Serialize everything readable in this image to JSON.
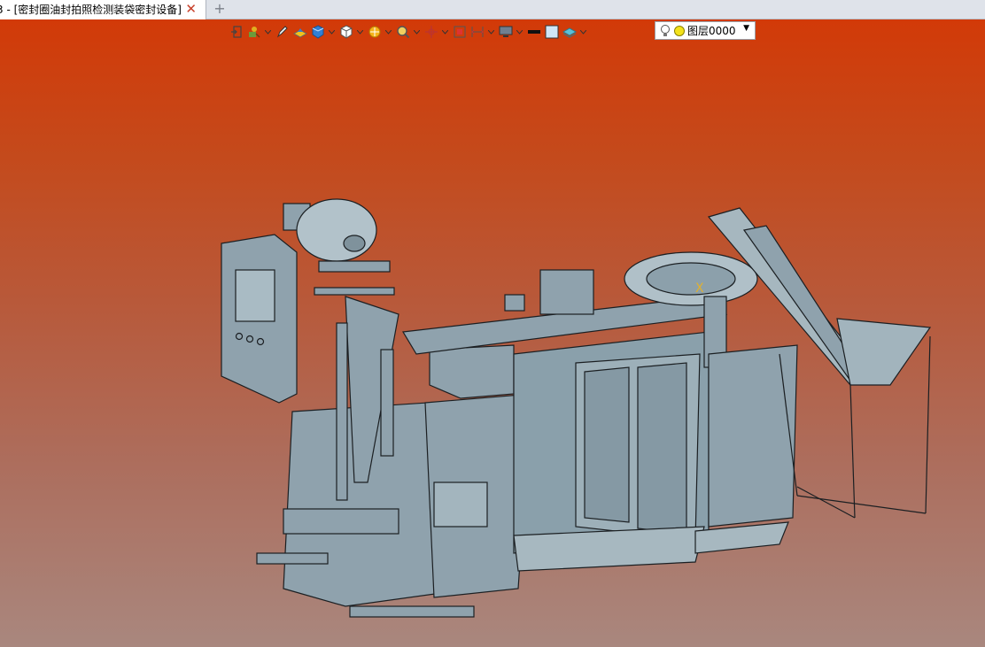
{
  "tab": {
    "title": "3 - [密封圈油封拍照检测装袋密封设备]",
    "close_glyph": "✕",
    "add_glyph": "+"
  },
  "toolbar": {
    "icons": [
      "exit-icon",
      "palette-icon",
      "pencil-icon",
      "part-icon",
      "cube-icon",
      "box-icon",
      "section-icon",
      "zoom-icon",
      "target-icon",
      "fit-icon",
      "dimension-icon",
      "monitor-icon",
      "line-icon",
      "fill-icon",
      "layer-stack-icon"
    ],
    "layer_name": "图层0000"
  },
  "colors": {
    "bg_top": "#d23a08",
    "bg_bottom": "#a9877e",
    "model_fill": "#8fa2ad",
    "model_edge": "#1b1f22"
  }
}
